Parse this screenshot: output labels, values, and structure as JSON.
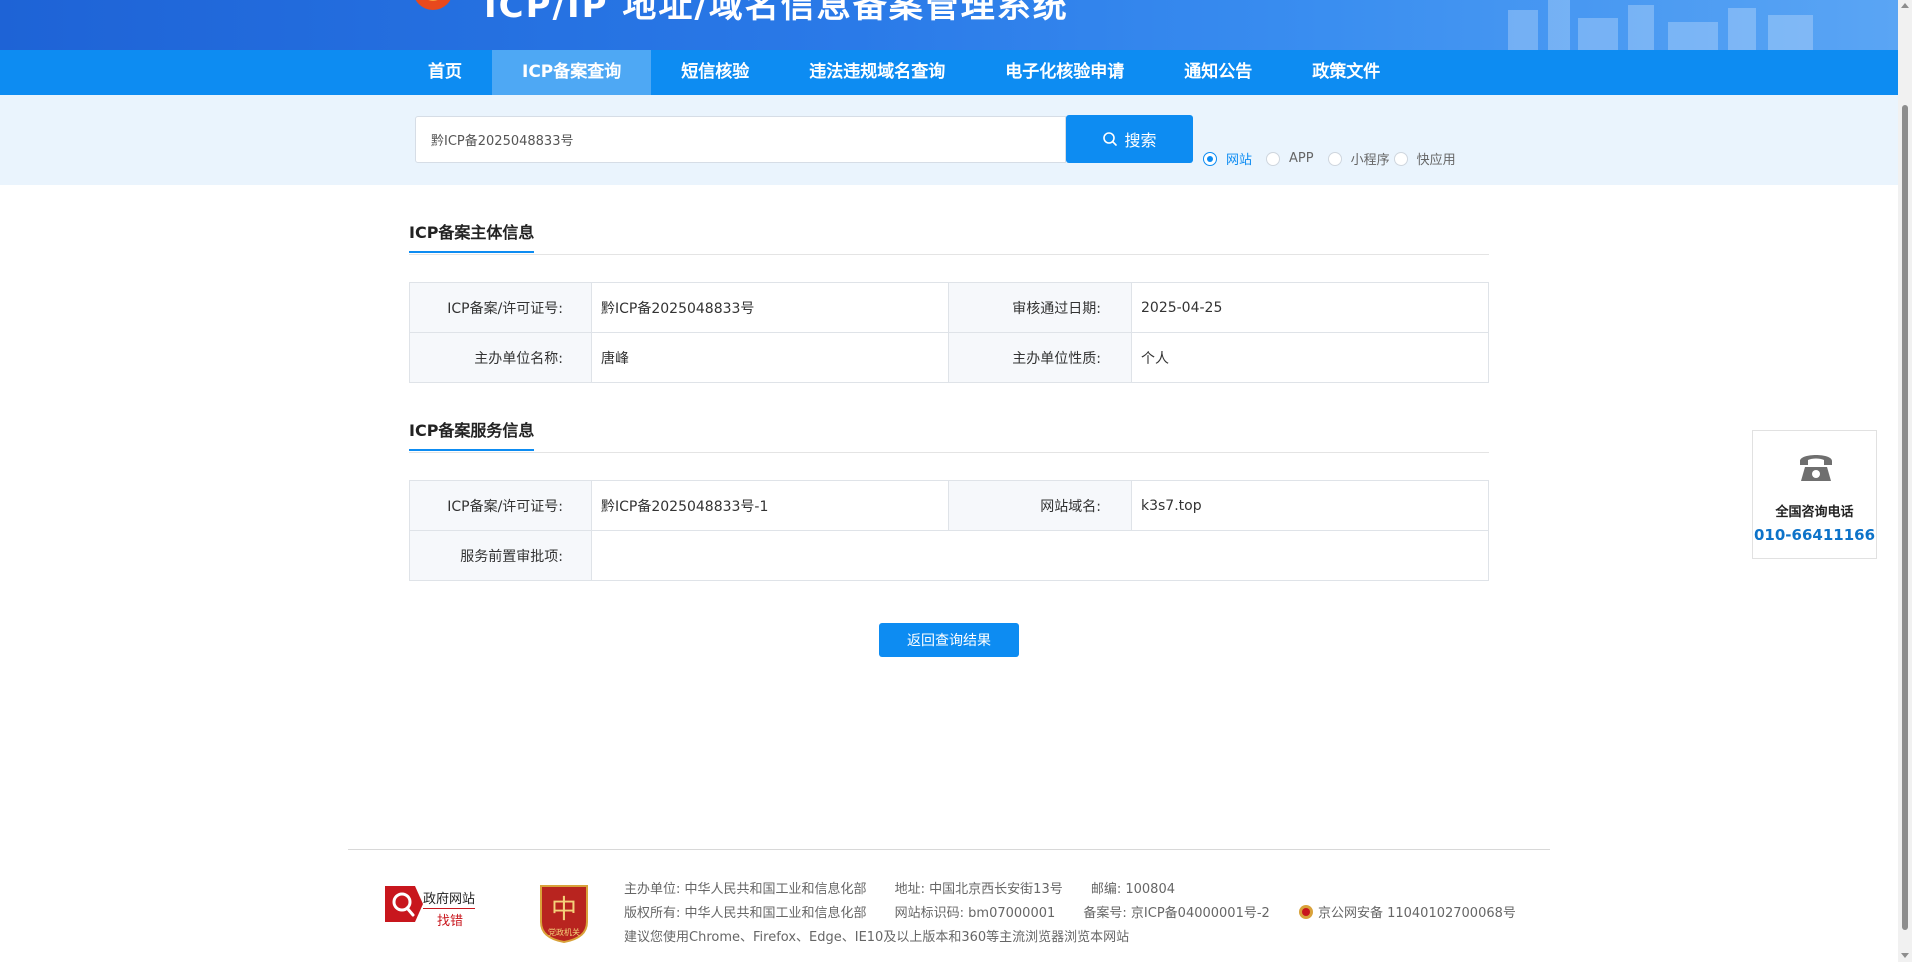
{
  "banner": {
    "title": "ICP/IP 地址/域名信息备案管理系统"
  },
  "nav": {
    "items": [
      {
        "label": "首页"
      },
      {
        "label": "ICP备案查询"
      },
      {
        "label": "短信核验"
      },
      {
        "label": "违法违规域名查询"
      },
      {
        "label": "电子化核验申请"
      },
      {
        "label": "通知公告"
      },
      {
        "label": "政策文件"
      }
    ],
    "active_index": 1
  },
  "search": {
    "value": "黔ICP备2025048833号",
    "button_label": "搜索",
    "types": [
      {
        "label": "网站",
        "checked": true
      },
      {
        "label": "APP",
        "checked": false
      },
      {
        "label": "小程序",
        "checked": false
      },
      {
        "label": "快应用",
        "checked": false
      }
    ]
  },
  "subject_info": {
    "heading": "ICP备案主体信息",
    "license_key": "ICP备案/许可证号:",
    "license_value": "黔ICP备2025048833号",
    "approve_date_key": "审核通过日期:",
    "approve_date_value": "2025-04-25",
    "org_name_key": "主办单位名称:",
    "org_name_value": "唐峰",
    "org_type_key": "主办单位性质:",
    "org_type_value": "个人"
  },
  "service_info": {
    "heading": "ICP备案服务信息",
    "license_key": "ICP备案/许可证号:",
    "license_value": "黔ICP备2025048833号-1",
    "domain_key": "网站域名:",
    "domain_value": "k3s7.top",
    "pre_approval_key": "服务前置审批项:",
    "pre_approval_value": ""
  },
  "back_button_label": "返回查询结果",
  "phone_widget": {
    "label": "全国咨询电话",
    "number": "010-66411166"
  },
  "footer": {
    "badge1_line1": "政府网站",
    "badge1_line2": "找错",
    "badge2_text": "党政机关",
    "host": "主办单位: 中华人民共和国工业和信息化部",
    "address": "地址: 中国北京西长安街13号",
    "postcode": "邮编: 100804",
    "copyright": "版权所有: 中华人民共和国工业和信息化部",
    "site_id": "网站标识码: bm07000001",
    "icp": "备案号: 京ICP备04000001号-2",
    "police": "京公网安备 11040102700068号",
    "browser_tip": "建议您使用Chrome、Firefox、Edge、IE10及以上版本和360等主流浏览器浏览本网站"
  },
  "colors": {
    "primary": "#0d8cf2",
    "nav_active": "#4ea8f4",
    "search_bg": "#eaf4fd",
    "phone_number": "#0d73c9"
  }
}
